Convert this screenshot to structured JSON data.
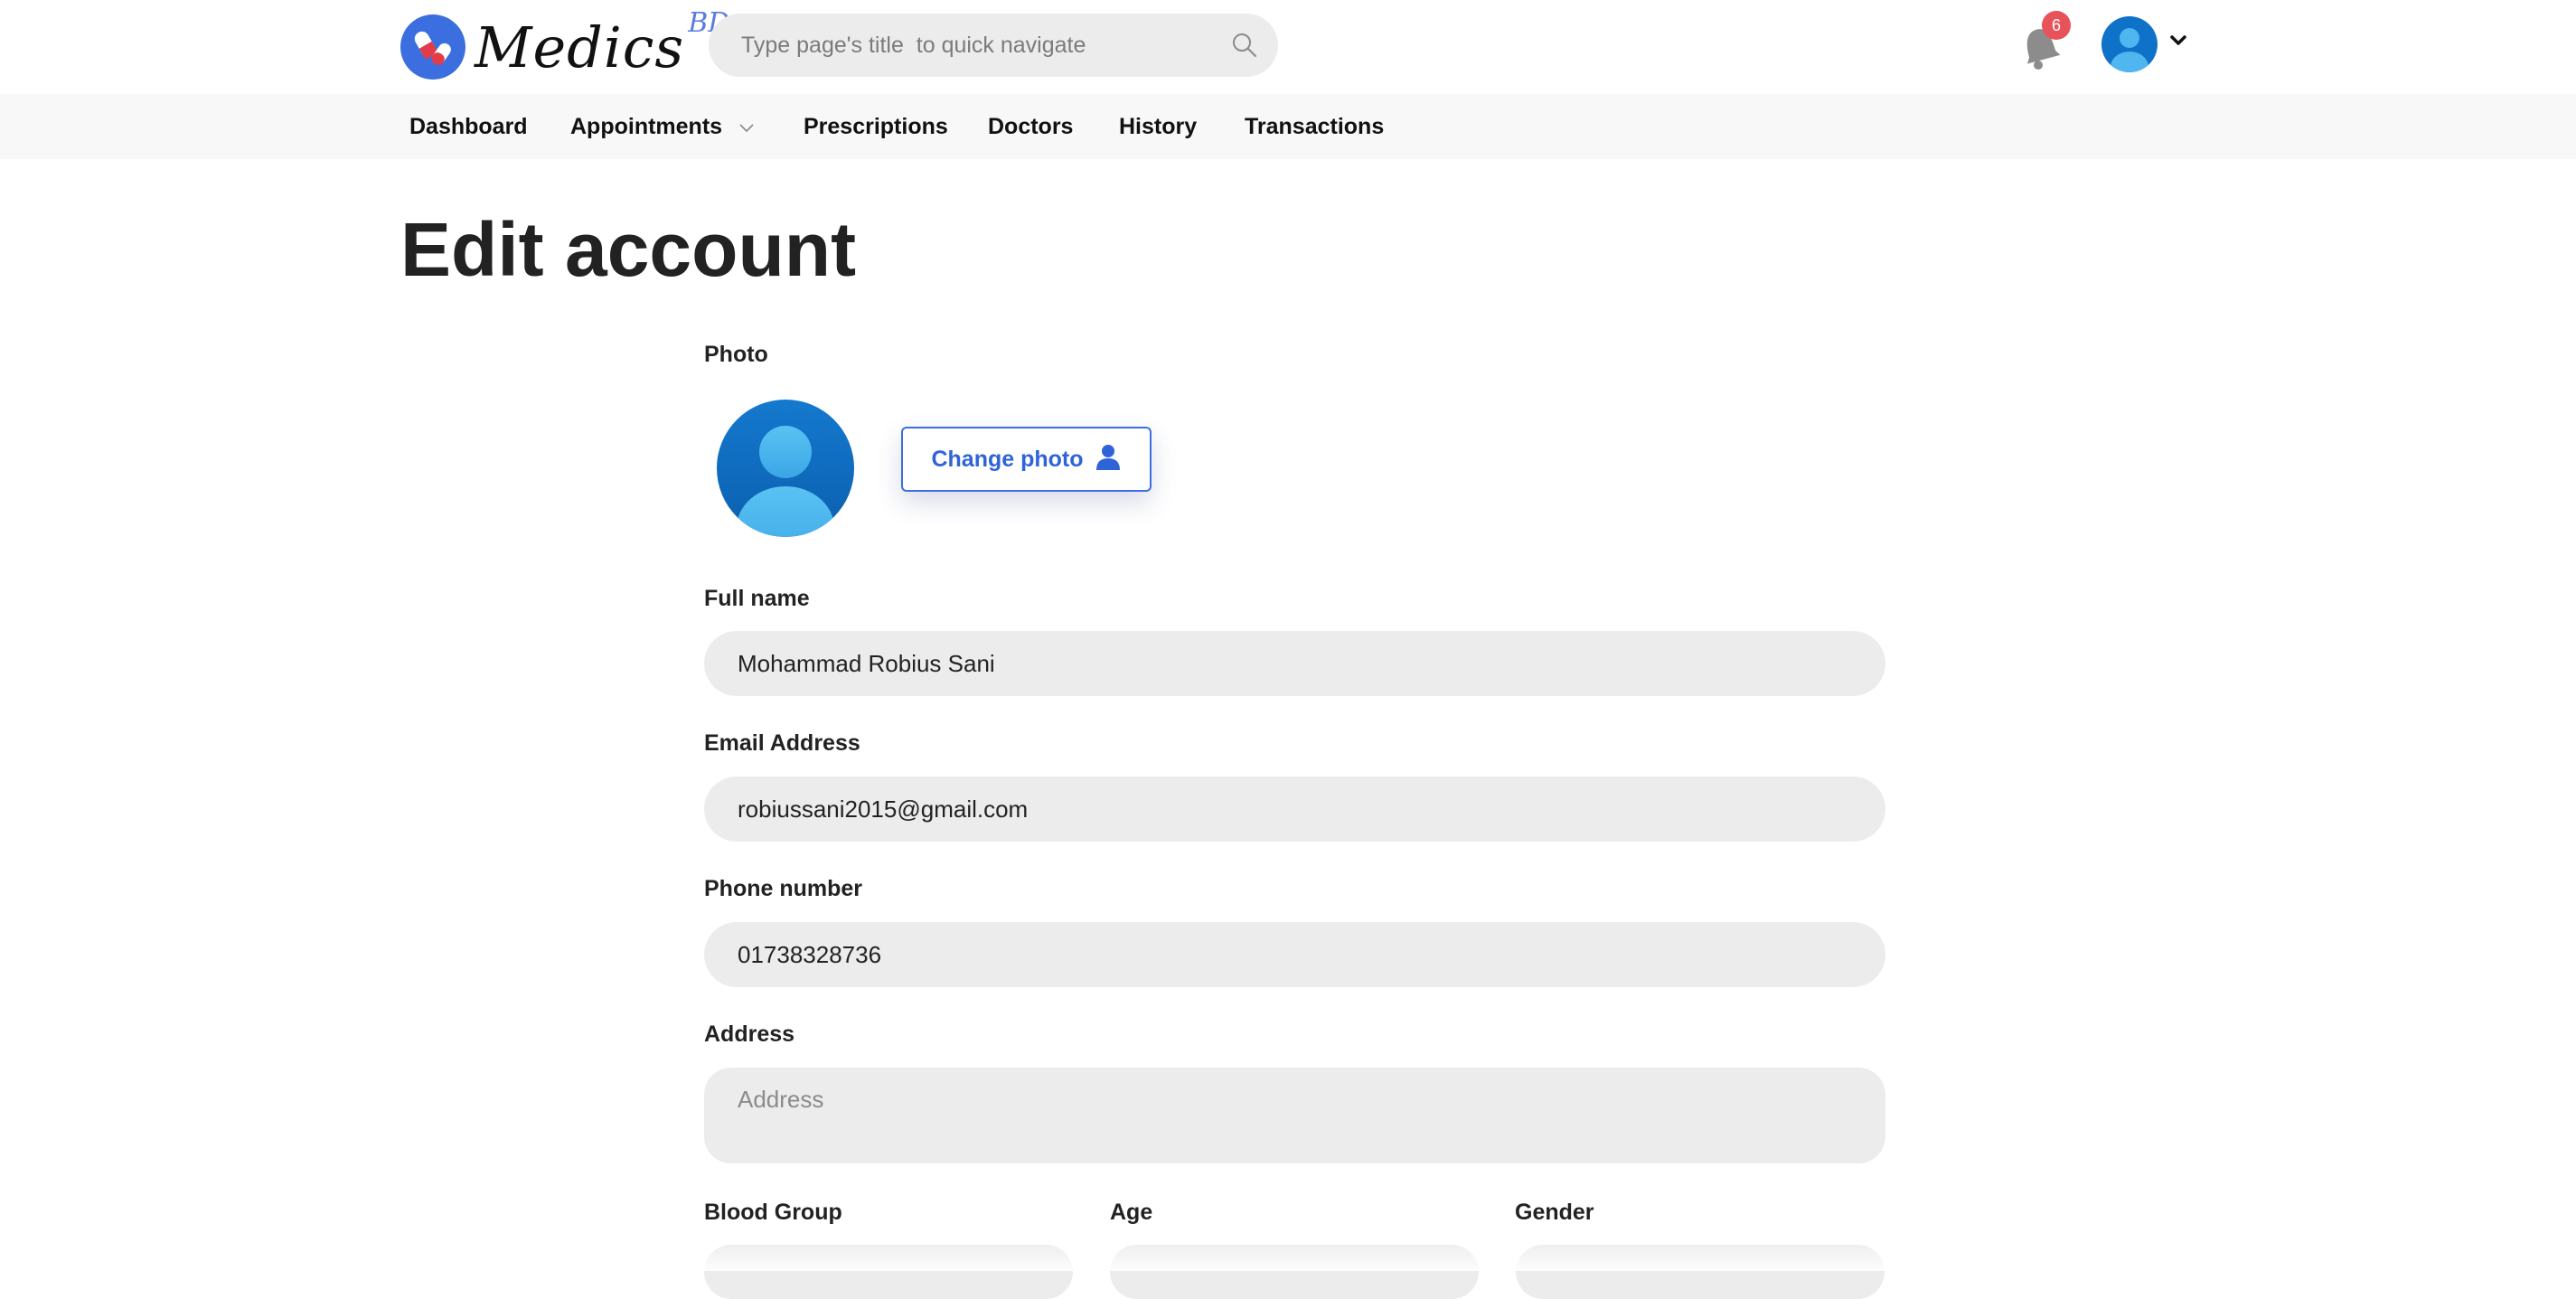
{
  "brand": {
    "name": "Medics",
    "suffix": "BD"
  },
  "search": {
    "placeholder": "Type page's title  to quick navigate"
  },
  "notifications": {
    "count": "6"
  },
  "nav": {
    "dashboard": "Dashboard",
    "appointments": "Appointments",
    "prescriptions": "Prescriptions",
    "doctors": "Doctors",
    "history": "History",
    "transactions": "Transactions"
  },
  "page": {
    "title": "Edit account"
  },
  "form": {
    "photo_label": "Photo",
    "change_photo": "Change photo",
    "full_name_label": "Full name",
    "full_name_value": "Mohammad Robius Sani",
    "email_label": "Email Address",
    "email_value": "robiussani2015@gmail.com",
    "phone_label": "Phone number",
    "phone_value": "01738328736",
    "address_label": "Address",
    "address_placeholder": "Address",
    "blood_group_label": "Blood Group",
    "age_label": "Age",
    "gender_label": "Gender"
  },
  "colors": {
    "accent": "#3b6fe0",
    "badge": "#e8535a",
    "field_bg": "#ececec"
  }
}
